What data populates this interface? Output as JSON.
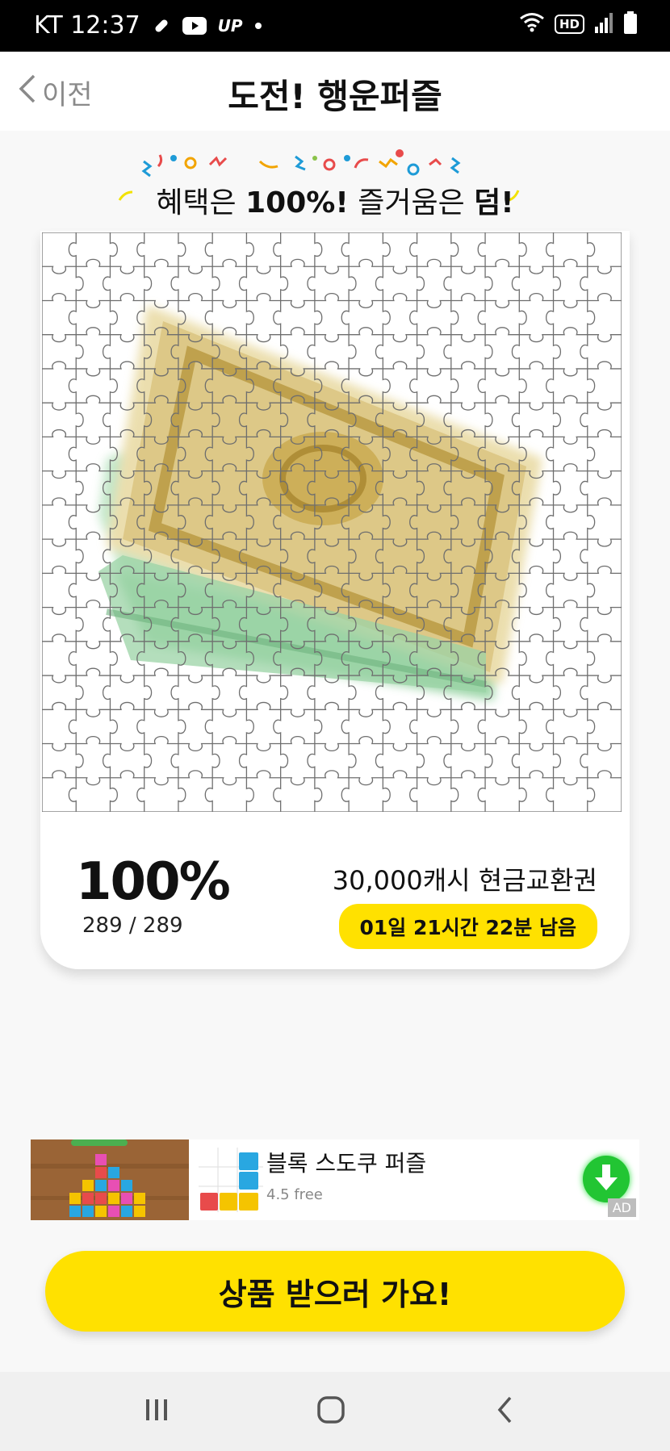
{
  "status_bar": {
    "carrier_time": "KT 12:37",
    "icons_left": [
      "bandage-icon",
      "youtube-icon",
      "up-icon",
      "dot-icon"
    ],
    "up_label": "UP",
    "hd_label": "HD",
    "icons_right": [
      "wifi-icon",
      "hd-icon",
      "signal-icon",
      "battery-icon"
    ]
  },
  "header": {
    "back_label": "이전",
    "title": "도전! 행운퍼즐"
  },
  "banner": {
    "slogan_part1": "혜택은 ",
    "slogan_bold1": "100%!",
    "slogan_part2": " 즐거움은 ",
    "slogan_bold2": "덤!"
  },
  "puzzle": {
    "columns": 17,
    "rows": 17,
    "pieces_done": 289,
    "pieces_total": 289
  },
  "progress": {
    "percent_text": "100%",
    "count_text": "289 / 289"
  },
  "prize": {
    "name": "30,000캐시 현금교환권",
    "remaining": "01일 21시간 22분 남음"
  },
  "ad": {
    "title": "블록 스도쿠 퍼즐",
    "rating": "4.5 free",
    "label": "AD"
  },
  "cta": {
    "label": "상품 받으러 가요!"
  },
  "colors": {
    "accent_yellow": "#ffe100",
    "gold": "#d8c27a",
    "bill_green": "#a8d9b0",
    "download_green": "#22c533"
  },
  "nav": {
    "icons": [
      "recent-apps-icon",
      "home-icon",
      "back-icon"
    ]
  }
}
